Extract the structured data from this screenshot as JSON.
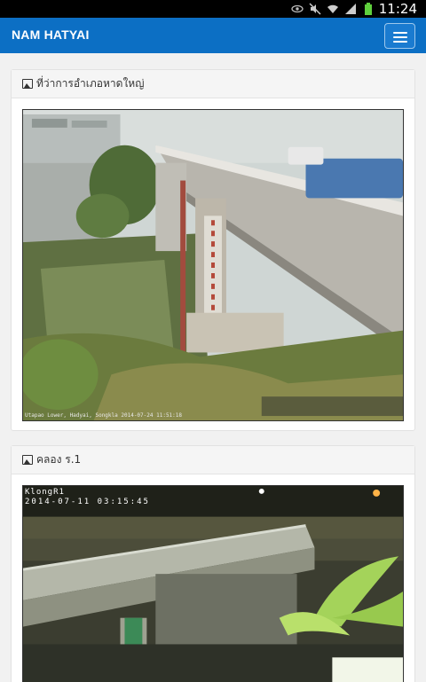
{
  "status_bar": {
    "time": "11:24",
    "icons": [
      "eye-icon",
      "mute-icon",
      "wifi-icon",
      "signal-icon",
      "battery-icon"
    ]
  },
  "navbar": {
    "brand": "NAM HATYAI",
    "menu_icon": "hamburger-menu-icon"
  },
  "colors": {
    "navbar": "#0c6fc4",
    "background": "#f1f1f1"
  },
  "cameras": [
    {
      "title": "ที่ว่าการอำเภอหาดใหญ่",
      "caption": "Utapao Lower, Hadyai, Songkla 2014-07-24 11:51:18"
    },
    {
      "title": "คลอง ร.1",
      "overlay_name": "KlongR1",
      "overlay_time": "2014-07-11 03:15:45"
    }
  ]
}
